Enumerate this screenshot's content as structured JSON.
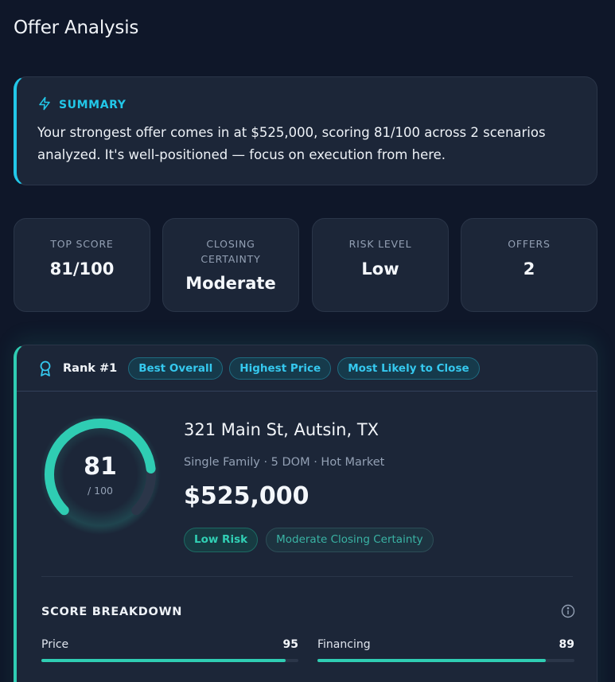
{
  "page": {
    "title": "Offer Analysis"
  },
  "summary": {
    "label": "SUMMARY",
    "text": "Your strongest offer comes in at $525,000, scoring 81/100 across 2 scenarios analyzed. It's well-positioned — focus on execution from here."
  },
  "stats": [
    {
      "label": "TOP SCORE",
      "value": "81/100"
    },
    {
      "label": "CLOSING CERTAINTY",
      "value": "Moderate"
    },
    {
      "label": "RISK LEVEL",
      "value": "Low"
    },
    {
      "label": "OFFERS",
      "value": "2"
    }
  ],
  "rank": {
    "title": "Rank #1",
    "tags": [
      "Best Overall",
      "Highest Price",
      "Most Likely to Close"
    ],
    "score": "81",
    "score_out_of": "/ 100",
    "score_fraction": 0.81,
    "address": "321 Main St, Autsin, TX",
    "meta": "Single Family · 5 DOM · Hot Market",
    "price": "$525,000",
    "badges": [
      "Low Risk",
      "Moderate Closing Certainty"
    ]
  },
  "breakdown": {
    "title": "SCORE BREAKDOWN",
    "items": [
      {
        "name": "Price",
        "value": "95",
        "fraction": 0.95
      },
      {
        "name": "Financing",
        "value": "89",
        "fraction": 0.89
      }
    ]
  },
  "colors": {
    "accent_cyan": "#22c7e8",
    "accent_teal": "#2fcdb3",
    "background": "#0f1729",
    "card": "#1c2638"
  }
}
